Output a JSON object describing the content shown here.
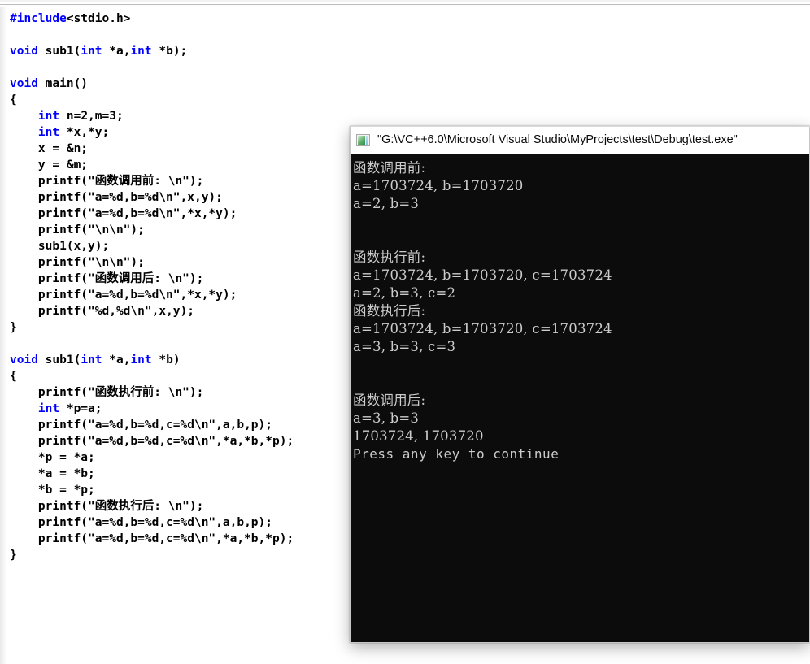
{
  "editor": {
    "name": "source-code-editor",
    "language": "c",
    "code_lines": [
      {
        "type": "code",
        "tokens": [
          {
            "t": "kw",
            "s": "#include"
          },
          {
            "t": "plain",
            "s": "<stdio.h>"
          }
        ]
      },
      {
        "type": "blank",
        "tokens": []
      },
      {
        "type": "code",
        "tokens": [
          {
            "t": "kw",
            "s": "void"
          },
          {
            "t": "plain",
            "s": " sub1("
          },
          {
            "t": "kw",
            "s": "int"
          },
          {
            "t": "plain",
            "s": " *a,"
          },
          {
            "t": "kw",
            "s": "int"
          },
          {
            "t": "plain",
            "s": " *b);"
          }
        ]
      },
      {
        "type": "blank",
        "tokens": []
      },
      {
        "type": "code",
        "tokens": [
          {
            "t": "kw",
            "s": "void"
          },
          {
            "t": "plain",
            "s": " main()"
          }
        ]
      },
      {
        "type": "code",
        "tokens": [
          {
            "t": "plain",
            "s": "{"
          }
        ]
      },
      {
        "type": "code",
        "tokens": [
          {
            "t": "plain",
            "s": "    "
          },
          {
            "t": "kw",
            "s": "int"
          },
          {
            "t": "plain",
            "s": " n=2,m=3;"
          }
        ]
      },
      {
        "type": "code",
        "tokens": [
          {
            "t": "plain",
            "s": "    "
          },
          {
            "t": "kw",
            "s": "int"
          },
          {
            "t": "plain",
            "s": " *x,*y;"
          }
        ]
      },
      {
        "type": "code",
        "tokens": [
          {
            "t": "plain",
            "s": "    x = &n;"
          }
        ]
      },
      {
        "type": "code",
        "tokens": [
          {
            "t": "plain",
            "s": "    y = &m;"
          }
        ]
      },
      {
        "type": "code",
        "tokens": [
          {
            "t": "plain",
            "s": "    printf(\"函数调用前: \\n\");"
          }
        ]
      },
      {
        "type": "code",
        "tokens": [
          {
            "t": "plain",
            "s": "    printf(\"a=%d,b=%d\\n\",x,y);"
          }
        ]
      },
      {
        "type": "code",
        "tokens": [
          {
            "t": "plain",
            "s": "    printf(\"a=%d,b=%d\\n\",*x,*y);"
          }
        ]
      },
      {
        "type": "code",
        "tokens": [
          {
            "t": "plain",
            "s": "    printf(\"\\n\\n\");"
          }
        ]
      },
      {
        "type": "code",
        "tokens": [
          {
            "t": "plain",
            "s": "    sub1(x,y);"
          }
        ]
      },
      {
        "type": "code",
        "tokens": [
          {
            "t": "plain",
            "s": "    printf(\"\\n\\n\");"
          }
        ]
      },
      {
        "type": "code",
        "tokens": [
          {
            "t": "plain",
            "s": "    printf(\"函数调用后: \\n\");"
          }
        ]
      },
      {
        "type": "code",
        "tokens": [
          {
            "t": "plain",
            "s": "    printf(\"a=%d,b=%d\\n\",*x,*y);"
          }
        ]
      },
      {
        "type": "code",
        "tokens": [
          {
            "t": "plain",
            "s": "    printf(\"%d,%d\\n\",x,y);"
          }
        ]
      },
      {
        "type": "code",
        "tokens": [
          {
            "t": "plain",
            "s": "}"
          }
        ]
      },
      {
        "type": "blank",
        "tokens": []
      },
      {
        "type": "code",
        "tokens": [
          {
            "t": "kw",
            "s": "void"
          },
          {
            "t": "plain",
            "s": " sub1("
          },
          {
            "t": "kw",
            "s": "int"
          },
          {
            "t": "plain",
            "s": " *a,"
          },
          {
            "t": "kw",
            "s": "int"
          },
          {
            "t": "plain",
            "s": " *b)"
          }
        ]
      },
      {
        "type": "code",
        "tokens": [
          {
            "t": "plain",
            "s": "{"
          }
        ]
      },
      {
        "type": "code",
        "tokens": [
          {
            "t": "plain",
            "s": "    printf(\"函数执行前: \\n\");"
          }
        ]
      },
      {
        "type": "code",
        "tokens": [
          {
            "t": "plain",
            "s": "    "
          },
          {
            "t": "kw",
            "s": "int"
          },
          {
            "t": "plain",
            "s": " *p=a;"
          }
        ]
      },
      {
        "type": "code",
        "tokens": [
          {
            "t": "plain",
            "s": "    printf(\"a=%d,b=%d,c=%d\\n\",a,b,p);"
          }
        ]
      },
      {
        "type": "code",
        "tokens": [
          {
            "t": "plain",
            "s": "    printf(\"a=%d,b=%d,c=%d\\n\",*a,*b,*p);"
          }
        ]
      },
      {
        "type": "code",
        "tokens": [
          {
            "t": "plain",
            "s": "    *p = *a;"
          }
        ]
      },
      {
        "type": "code",
        "tokens": [
          {
            "t": "plain",
            "s": "    *a = *b;"
          }
        ]
      },
      {
        "type": "code",
        "tokens": [
          {
            "t": "plain",
            "s": "    *b = *p;"
          }
        ]
      },
      {
        "type": "code",
        "tokens": [
          {
            "t": "plain",
            "s": "    printf(\"函数执行后: \\n\");"
          }
        ]
      },
      {
        "type": "code",
        "tokens": [
          {
            "t": "plain",
            "s": "    printf(\"a=%d,b=%d,c=%d\\n\",a,b,p);"
          }
        ]
      },
      {
        "type": "code",
        "tokens": [
          {
            "t": "plain",
            "s": "    printf(\"a=%d,b=%d,c=%d\\n\",*a,*b,*p);"
          }
        ]
      },
      {
        "type": "code",
        "tokens": [
          {
            "t": "plain",
            "s": "}"
          }
        ]
      }
    ]
  },
  "console": {
    "name": "console-window",
    "icon": "console-app-icon",
    "title": "\"G:\\VC++6.0\\Microsoft Visual Studio\\MyProjects\\test\\Debug\\test.exe\"",
    "output_lines": [
      {
        "text": "函数调用前:",
        "style": "serif"
      },
      {
        "text": "a=1703724, b=1703720",
        "style": "serif"
      },
      {
        "text": "a=2, b=3",
        "style": "serif"
      },
      {
        "text": "",
        "style": "serif"
      },
      {
        "text": "",
        "style": "serif"
      },
      {
        "text": "函数执行前:",
        "style": "serif"
      },
      {
        "text": "a=1703724, b=1703720, c=1703724",
        "style": "serif"
      },
      {
        "text": "a=2, b=3, c=2",
        "style": "serif"
      },
      {
        "text": "函数执行后:",
        "style": "serif"
      },
      {
        "text": "a=1703724, b=1703720, c=1703724",
        "style": "serif"
      },
      {
        "text": "a=3, b=3, c=3",
        "style": "serif"
      },
      {
        "text": "",
        "style": "serif"
      },
      {
        "text": "",
        "style": "serif"
      },
      {
        "text": "函数调用后:",
        "style": "serif"
      },
      {
        "text": "a=3, b=3",
        "style": "serif"
      },
      {
        "text": "1703724, 1703720",
        "style": "serif"
      },
      {
        "text": "Press any key to continue",
        "style": "mono"
      }
    ]
  },
  "colors": {
    "editor_background": "#ffffff",
    "code_text": "#000000",
    "code_keyword": "#0000ff",
    "console_background": "#0c0c0c",
    "console_text": "#cccccc",
    "titlebar_background": "#ffffff",
    "titlebar_text": "#0a0a0a"
  }
}
